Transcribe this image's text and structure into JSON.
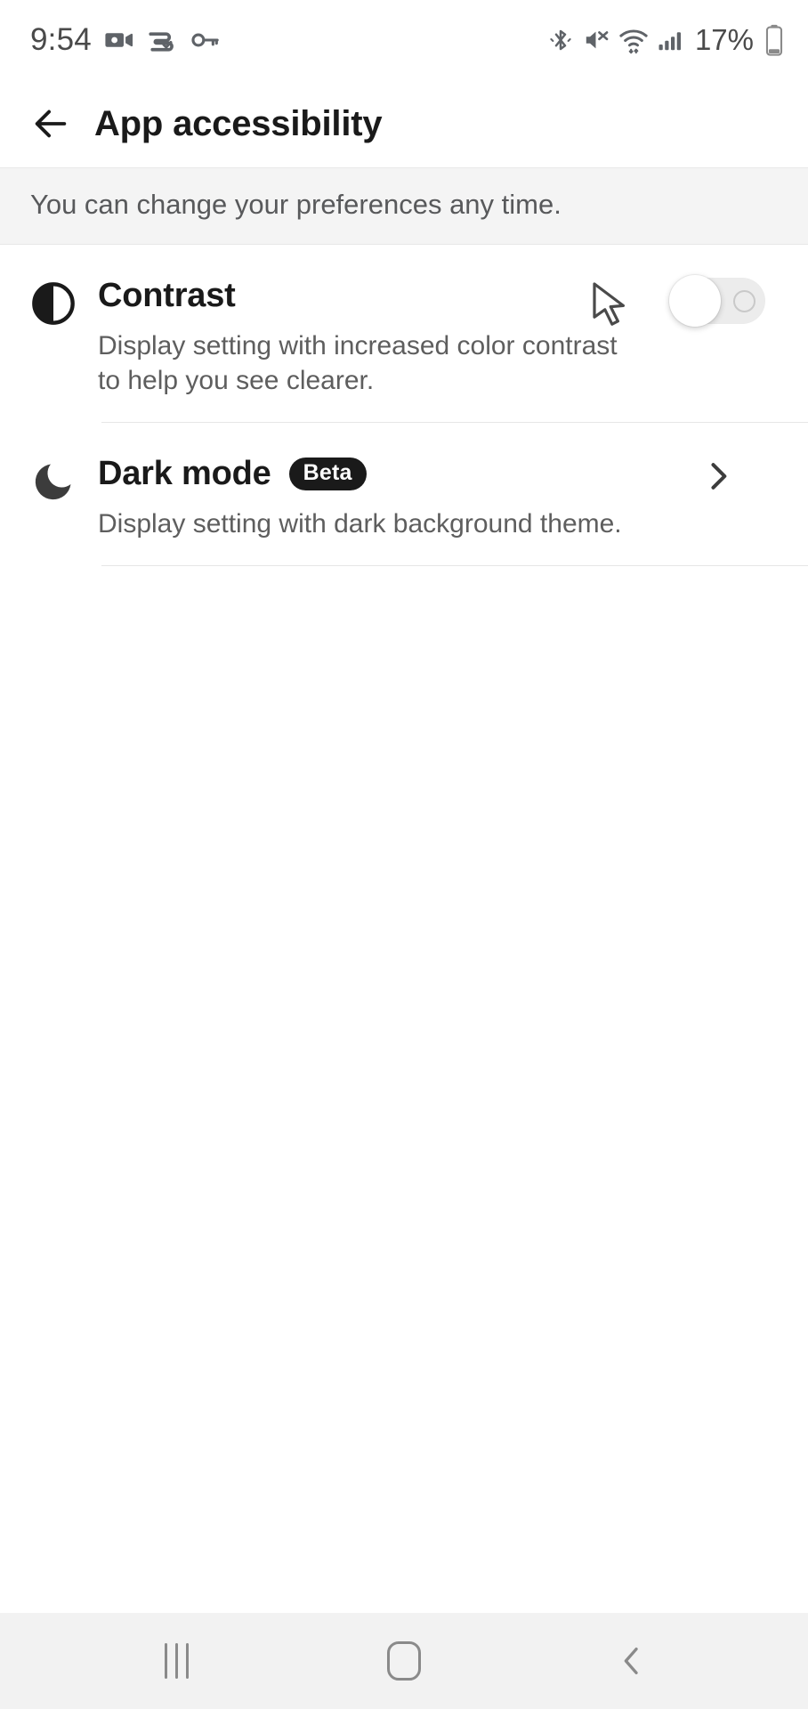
{
  "status_bar": {
    "time": "9:54",
    "battery_percent": "17%",
    "left_icons": [
      "camcorder-icon",
      "vpn-key-shield-icon",
      "key-icon"
    ],
    "right_icons": [
      "bluetooth-icon",
      "volume-mute-icon",
      "wifi-icon",
      "cellular-signal-icon",
      "battery-icon"
    ]
  },
  "header": {
    "back_label": "back-arrow-icon",
    "title": "App accessibility"
  },
  "notice": {
    "text": "You can change your preferences any time."
  },
  "settings": {
    "items": [
      {
        "id": "contrast",
        "icon": "contrast-half-circle-icon",
        "title": "Contrast",
        "badge": "",
        "description": "Display setting with increased color contrast to help you see clearer.",
        "control": "toggle",
        "toggle_state": "off"
      },
      {
        "id": "dark-mode",
        "icon": "moon-crescent-icon",
        "title": "Dark mode",
        "badge": "Beta",
        "description": "Display setting with dark background theme.",
        "control": "chevron",
        "toggle_state": ""
      }
    ]
  },
  "nav_bar": {
    "recents_label": "recents-button",
    "home_label": "home-button",
    "back_label": "back-button"
  },
  "colors": {
    "page_bg": "#ffffff",
    "banner_bg": "#f4f4f4",
    "text_primary": "#1a1a1a",
    "text_secondary": "#5e5e5e",
    "divider": "#e6e6e6",
    "badge_bg": "#1a1a1a",
    "toggle_track_off": "#ececec",
    "nav_bg": "#f2f2f2"
  }
}
